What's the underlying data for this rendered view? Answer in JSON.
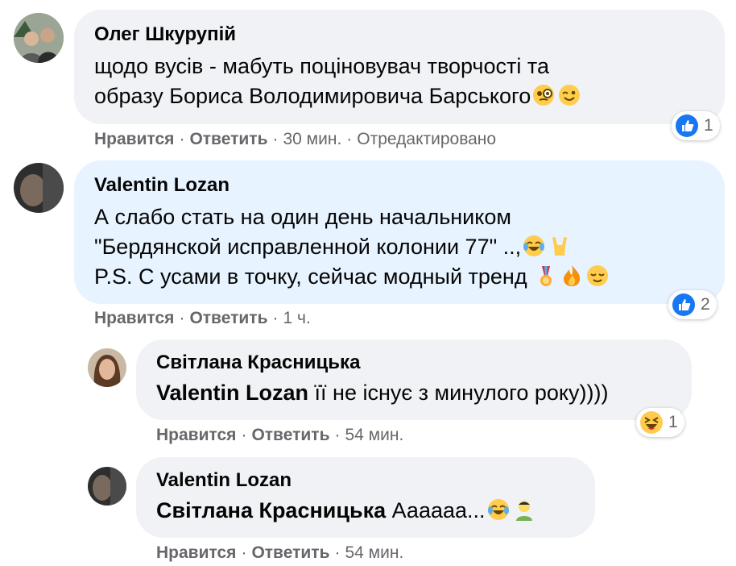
{
  "comments": [
    {
      "author": "Олег Шкурупій",
      "lines": [
        "щодо вусів - мабуть поціновувач творчості та",
        "образу Бориса Володимировича Барського"
      ],
      "actions": {
        "like": "Нравится",
        "reply": "Ответить",
        "time": "30 мин.",
        "edited": "Отредактировано"
      },
      "reaction": {
        "icon": "like-icon",
        "count": "1"
      }
    },
    {
      "author": "Valentin Lozan",
      "lines": [
        "А слабо стать на один день начальником",
        "\"Бердянской исправленной колонии 77\" ..,",
        "P.S. С усами в точку, сейчас модный тренд "
      ],
      "actions": {
        "like": "Нравится",
        "reply": "Ответить",
        "time": "1 ч."
      },
      "reaction": {
        "icon": "like-icon",
        "count": "2"
      }
    },
    {
      "author": "Світлана Красницька",
      "mention": "Valentin Lozan",
      "text": " її не існує з минулого року))))",
      "actions": {
        "like": "Нравится",
        "reply": "Ответить",
        "time": "54 мин."
      },
      "reaction": {
        "icon": "haha-icon",
        "count": "1"
      }
    },
    {
      "author": "Valentin Lozan",
      "mention": "Світлана Красницька",
      "text": " Аааааа...",
      "actions": {
        "like": "Нравится",
        "reply": "Ответить",
        "time": "54 мин."
      }
    }
  ],
  "colors": {
    "bubble": "#f0f2f5",
    "bubble_highlight": "#e7f3ff",
    "like_blue": "#1877f2",
    "meta": "#65676b"
  }
}
